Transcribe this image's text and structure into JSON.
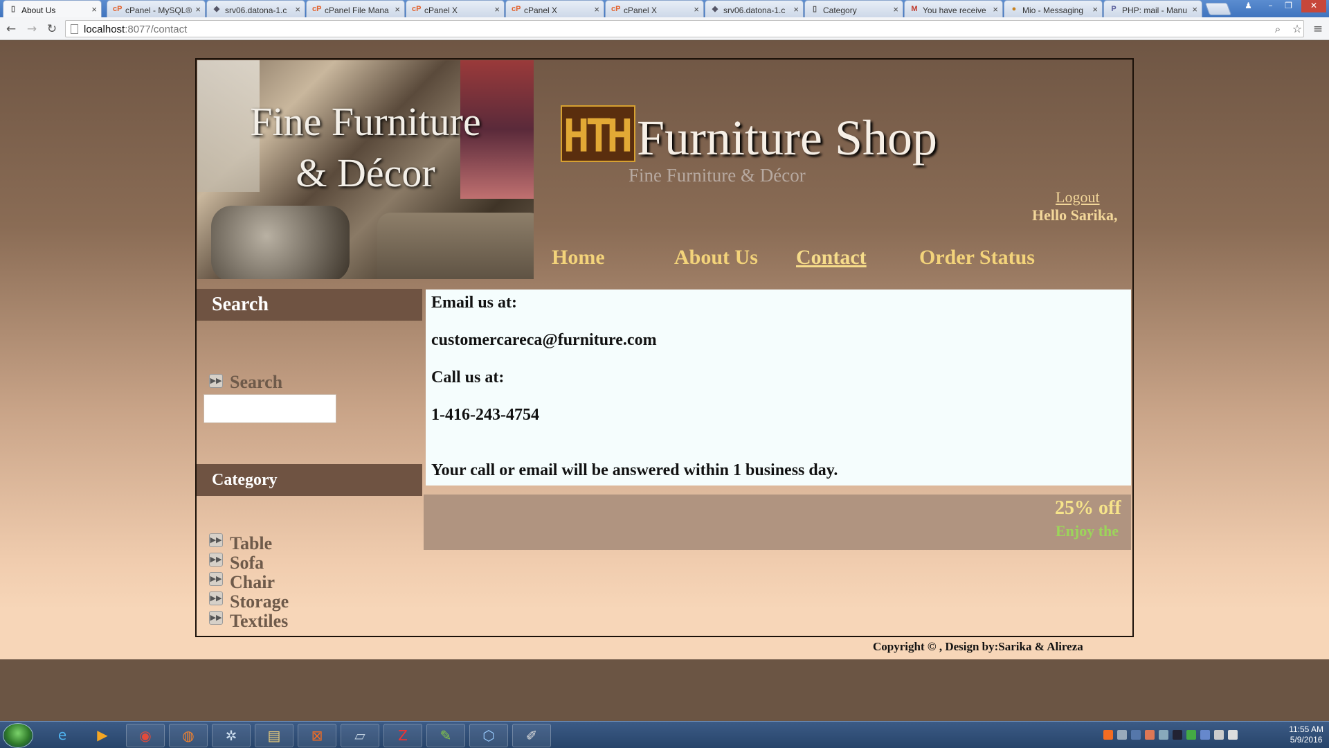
{
  "browser": {
    "tabs": [
      {
        "title": "About Us",
        "icon": "page-icon",
        "active": true
      },
      {
        "title": "cPanel - MySQL®",
        "icon": "cpanel-icon"
      },
      {
        "title": "srv06.datona-1.c",
        "icon": "pma-icon"
      },
      {
        "title": "cPanel File Mana",
        "icon": "cpanel-icon"
      },
      {
        "title": "cPanel X",
        "icon": "cpanel-icon"
      },
      {
        "title": "cPanel X",
        "icon": "cpanel-icon"
      },
      {
        "title": "cPanel X",
        "icon": "cpanel-icon"
      },
      {
        "title": "srv06.datona-1.c",
        "icon": "pma-icon"
      },
      {
        "title": "Category",
        "icon": "page-icon"
      },
      {
        "title": "You have receive",
        "icon": "gmail-icon"
      },
      {
        "title": "Mio - Messaging",
        "icon": "mio-icon"
      },
      {
        "title": "PHP: mail - Manu",
        "icon": "php-icon"
      }
    ],
    "url_host": "localhost",
    "url_path": ":8077/contact"
  },
  "site": {
    "banner_line1": "Fine Furniture",
    "banner_line2": "& Décor",
    "shop_name": "Furniture Shop",
    "tagline": "Fine Furniture & Décor",
    "logout": "Logout",
    "hello": "Hello Sarika,",
    "nav": [
      {
        "label": "Home"
      },
      {
        "label": "About Us"
      },
      {
        "label": "Contact",
        "current": true
      },
      {
        "label": "Order Status"
      }
    ]
  },
  "sidebar": {
    "search_heading": "Search",
    "search_label": "Search",
    "search_value": "",
    "category_heading": "Category",
    "categories": [
      "Table",
      "Sofa",
      "Chair",
      "Storage",
      "Textiles"
    ]
  },
  "content": {
    "email_heading": "Email us at:",
    "email": "customercareca@furniture.com",
    "call_heading": "Call us at:",
    "phone": "1-416-243-4754",
    "note": "Your call or email will be answered within 1 business day."
  },
  "promo": {
    "line1": "25% off",
    "line2": "Enjoy the"
  },
  "footer": {
    "copyright": "Copyright © , Design by:Sarika & Alireza"
  },
  "taskbar": {
    "clock_time": "11:55 AM",
    "clock_date": "5/9/2016"
  }
}
